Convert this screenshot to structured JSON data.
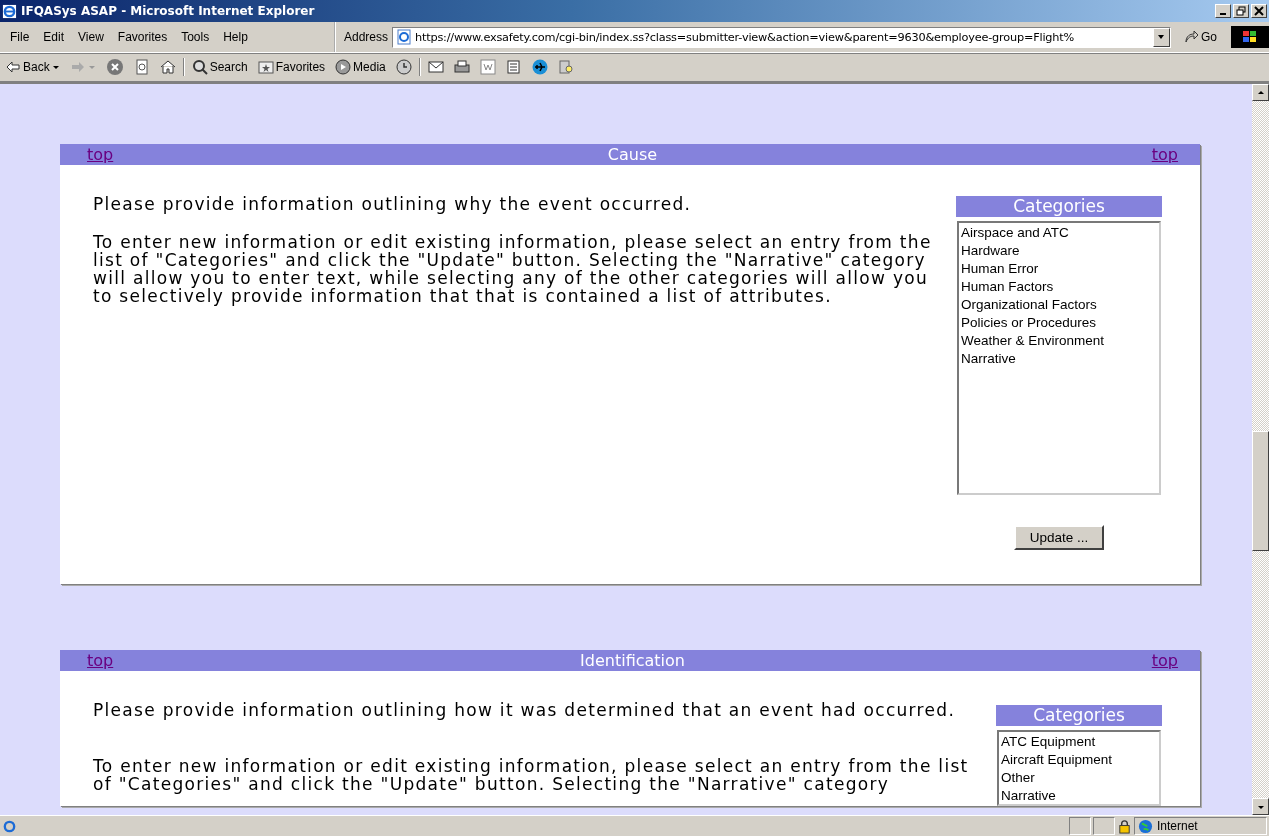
{
  "window": {
    "title": "IFQASys ASAP - Microsoft Internet Explorer"
  },
  "menu": [
    "File",
    "Edit",
    "View",
    "Favorites",
    "Tools",
    "Help"
  ],
  "address": {
    "label": "Address",
    "value": "https://www.exsafety.com/cgi-bin/index.ss?class=submitter-view&action=view&parent=9630&employee-group=Flight%",
    "go": "Go"
  },
  "toolbar": {
    "back": "Back",
    "search": "Search",
    "favorites": "Favorites",
    "media": "Media"
  },
  "sections": [
    {
      "title": "Cause",
      "top_left": "top",
      "top_right": "top",
      "intro": "Please provide information outlining why the event occurred.",
      "instructions": "To enter new information or edit existing information, please select an entry from the list of \"Categories\" and click the \"Update\" button. Selecting the \"Narrative\" category will allow you to enter text, while selecting any of the other categories will allow you to selectively provide information that that is contained a list of attributes.",
      "categories_title": "Categories",
      "categories": [
        {
          "label": "Airspace and ATC",
          "selected": false
        },
        {
          "label": "Hardware",
          "selected": false
        },
        {
          "label": "Human Error",
          "selected": false
        },
        {
          "label": "Human Factors",
          "selected": false
        },
        {
          "label": "Organizational Factors",
          "selected": false
        },
        {
          "label": "Policies or Procedures",
          "selected": false
        },
        {
          "label": "Weather & Environment",
          "selected": false
        },
        {
          "label": "Narrative",
          "selected": false
        }
      ],
      "button": "Update ..."
    },
    {
      "title": "Identification",
      "top_left": "top",
      "top_right": "top",
      "intro": "Please provide information outlining how it was determined that an event had occurred.",
      "instructions": "To enter new information or edit existing information, please select an entry from the list of \"Categories\" and click the \"Update\" button. Selecting the \"Narrative\" category",
      "categories_title": "Categories",
      "categories": [
        {
          "label": "ATC Equipment",
          "selected": false
        },
        {
          "label": "Aircraft Equipment",
          "selected": false
        },
        {
          "label": "Other",
          "selected": false
        },
        {
          "label": "Narrative",
          "selected": false
        }
      ]
    }
  ],
  "status_bar": {
    "zone": "Internet"
  }
}
